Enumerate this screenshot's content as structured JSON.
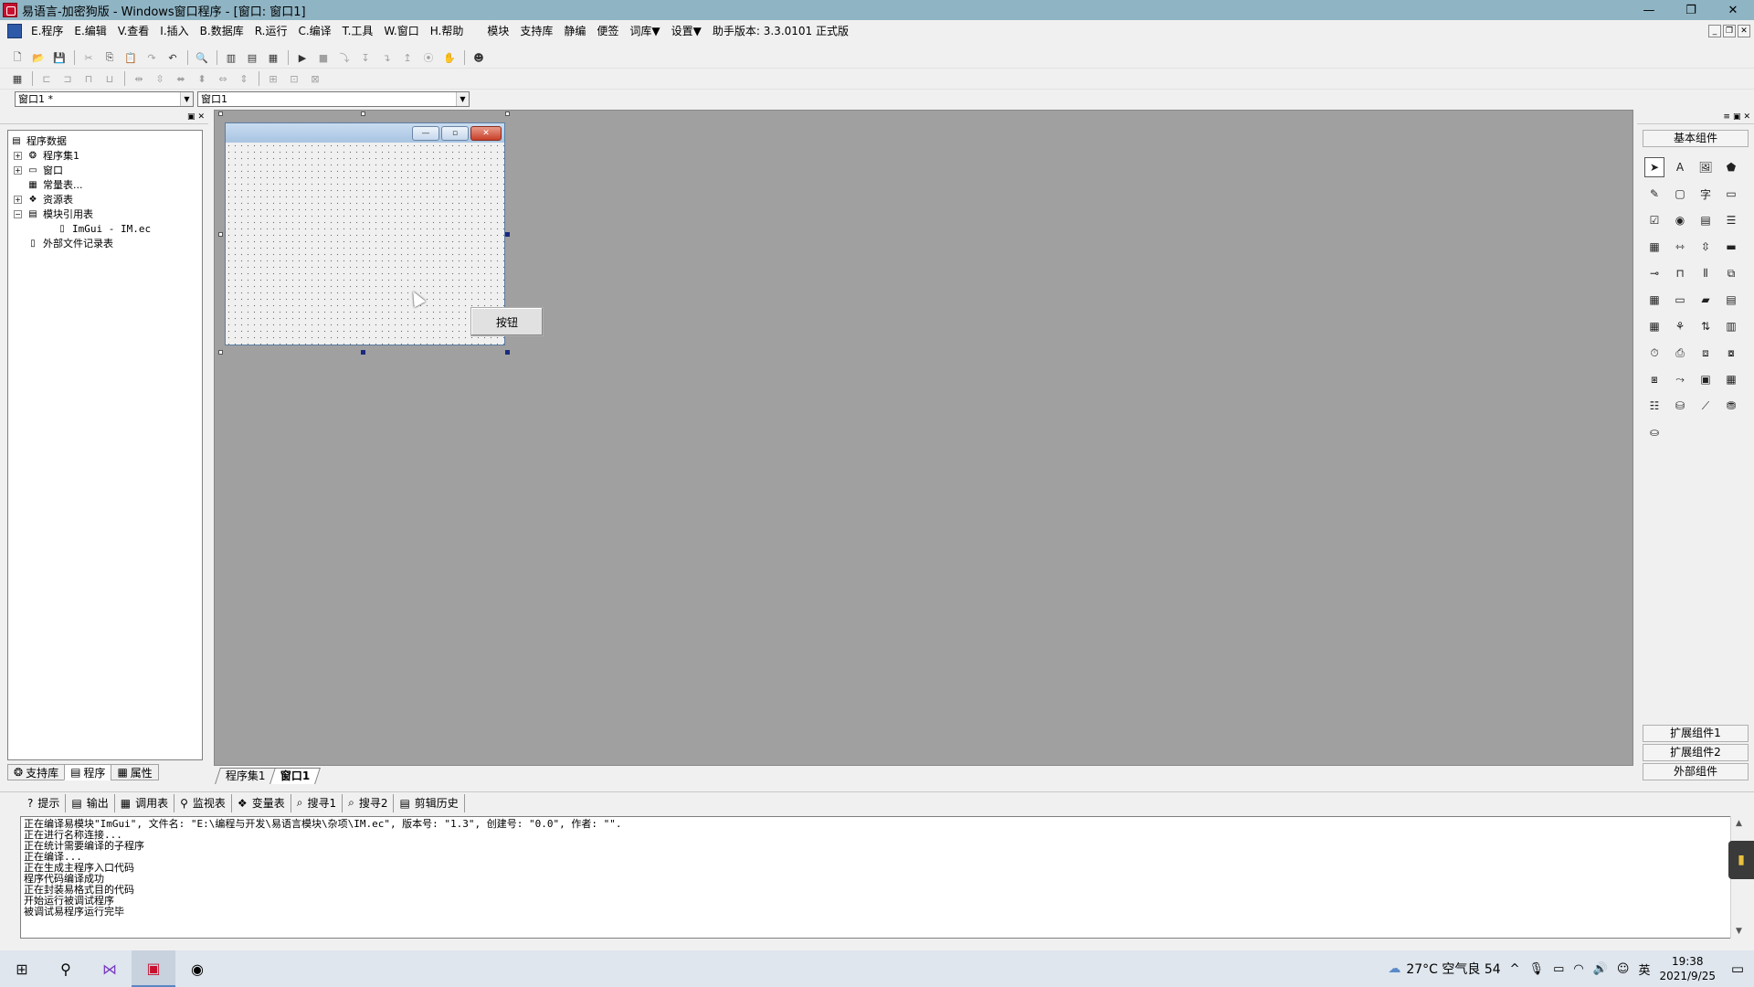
{
  "window": {
    "title": "易语言-加密狗版 - Windows窗口程序 - [窗口: 窗口1]",
    "minimize": "—",
    "restore": "❐",
    "close": "✕"
  },
  "menu": [
    "E.程序",
    "E.编辑",
    "V.查看",
    "I.插入",
    "B.数据库",
    "R.运行",
    "C.编译",
    "T.工具",
    "W.窗口",
    "H.帮助",
    "模块",
    "支持库",
    "静编",
    "便签",
    "词库▼",
    "设置▼",
    "助手版本: 3.3.0101 正式版"
  ],
  "combos": {
    "left": "窗口1 *",
    "right": "窗口1"
  },
  "tree": {
    "root": "程序数据",
    "items": [
      {
        "label": "程序集1",
        "expander": "+",
        "icon": "❂"
      },
      {
        "label": "窗口",
        "expander": "+",
        "icon": "▭"
      },
      {
        "label": "常量表...",
        "expander": "",
        "icon": "▦"
      },
      {
        "label": "资源表",
        "expander": "+",
        "icon": "❖"
      },
      {
        "label": "模块引用表",
        "expander": "−",
        "icon": "▤"
      },
      {
        "label": "ImGui - IM.ec",
        "expander": "",
        "icon": "▯"
      },
      {
        "label": "外部文件记录表",
        "expander": "",
        "icon": "▯"
      }
    ]
  },
  "left_tabs": [
    "支持库",
    "程序",
    "属性"
  ],
  "form": {
    "button_label": "按钮"
  },
  "design_tabs": [
    "程序集1",
    "窗口1"
  ],
  "toolbox": {
    "header": "基本组件",
    "groups": [
      "扩展组件1",
      "扩展组件2",
      "外部组件"
    ]
  },
  "output_tabs": [
    "提示",
    "输出",
    "调用表",
    "监视表",
    "变量表",
    "搜寻1",
    "搜寻2",
    "剪辑历史"
  ],
  "output_lines": [
    "正在编译易模块\"ImGui\", 文件名: \"E:\\编程与开发\\易语言模块\\杂项\\IM.ec\", 版本号: \"1.3\", 创建号: \"0.0\", 作者: \"\".",
    "正在进行名称连接...",
    "正在统计需要编译的子程序",
    "正在编译...",
    "正在生成主程序入口代码",
    "程序代码编译成功",
    "正在封装易格式目的代码",
    "开始运行被调试程序",
    "被调试易程序运行完毕"
  ],
  "taskbar": {
    "weather": "27°C 空气良 54",
    "ime": "英",
    "time": "19:38",
    "date": "2021/9/25"
  }
}
